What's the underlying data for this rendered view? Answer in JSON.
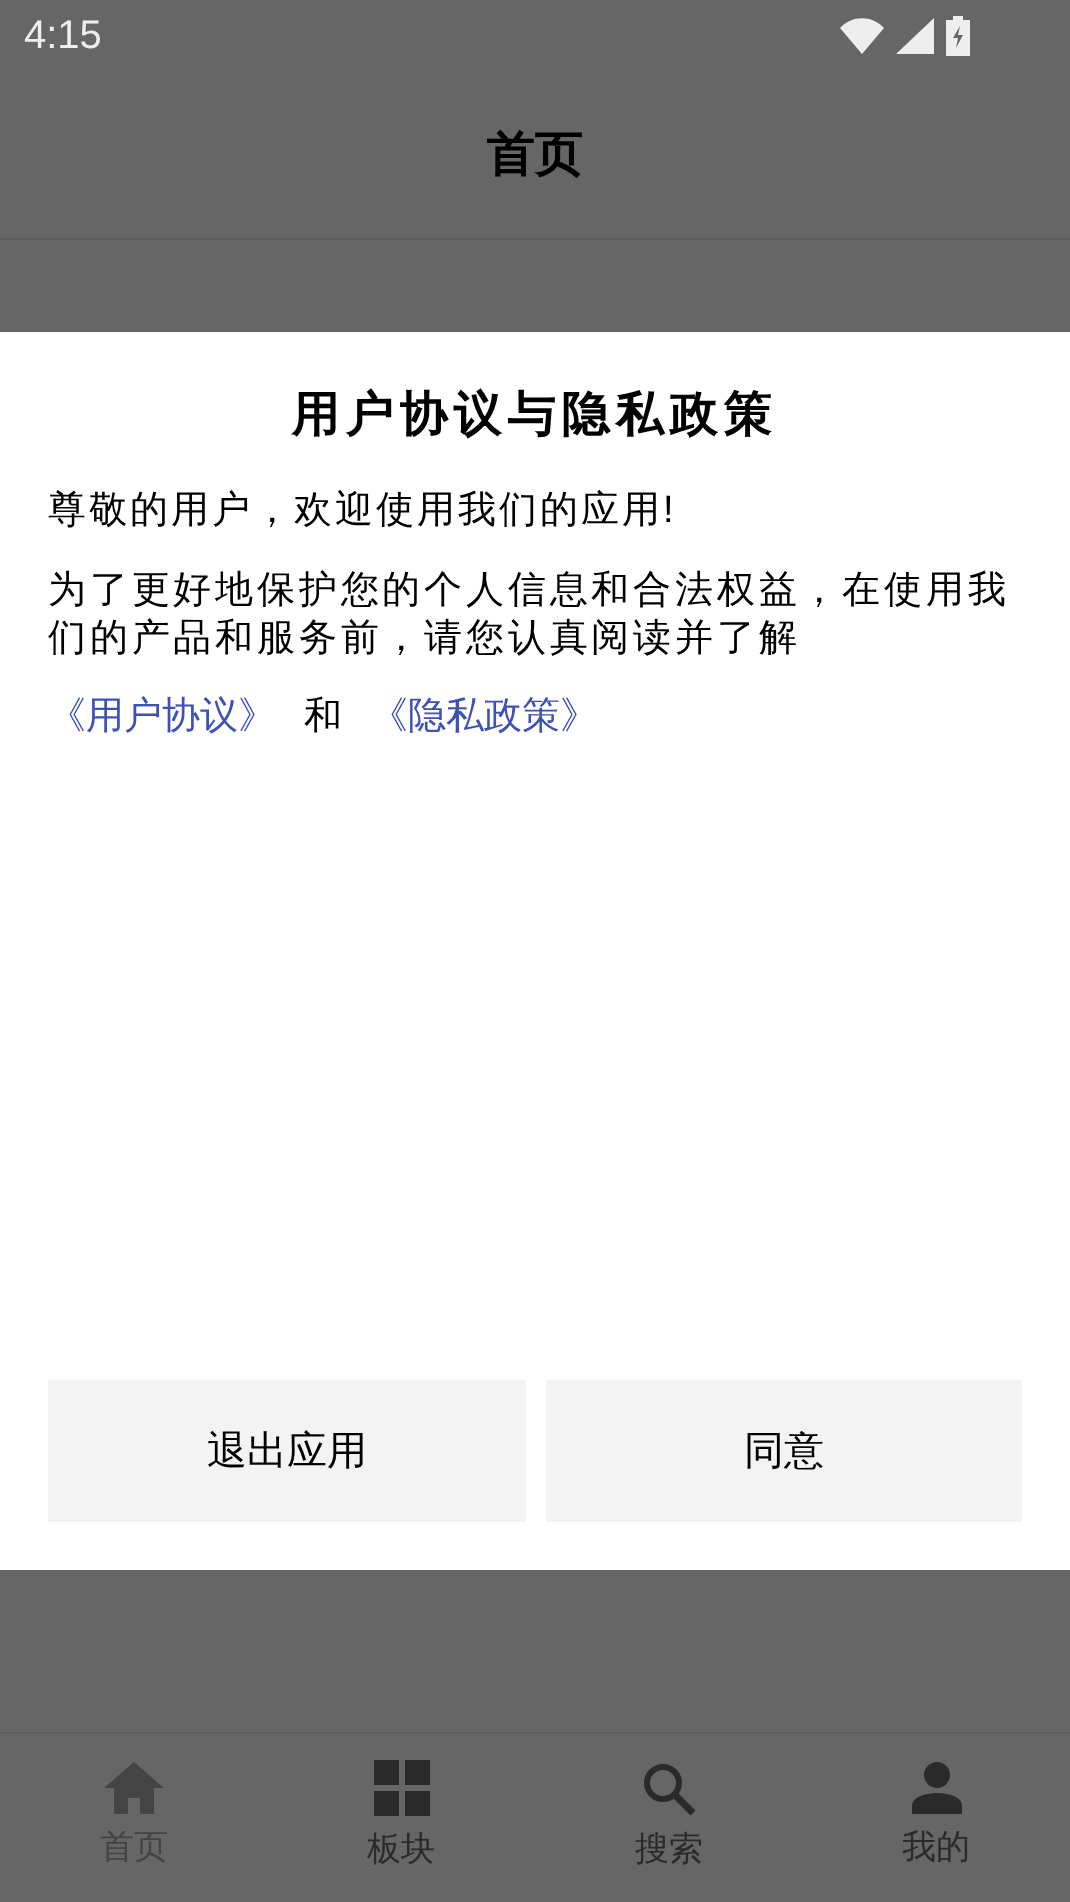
{
  "status_bar": {
    "time": "4:15"
  },
  "header": {
    "title": "首页"
  },
  "dialog": {
    "title": "用户协议与隐私政策",
    "greeting": "尊敬的用户，欢迎使用我们的应用!",
    "body": "为了更好地保护您的个人信息和合法权益，在使用我们的产品和服务前，请您认真阅读并了解",
    "links": [
      {
        "kind": "link",
        "text": "《用户协议》"
      },
      {
        "kind": "text",
        "text": "和"
      },
      {
        "kind": "link",
        "text": "《隐私政策》"
      }
    ],
    "buttons": [
      "退出应用",
      "同意"
    ]
  },
  "bottom_nav": [
    {
      "label": "首页",
      "kind": "home",
      "selected": true
    },
    {
      "label": "板块",
      "kind": "grid",
      "selected": false
    },
    {
      "label": "搜索",
      "kind": "search",
      "selected": false
    },
    {
      "label": "我的",
      "kind": "person",
      "selected": false
    }
  ]
}
